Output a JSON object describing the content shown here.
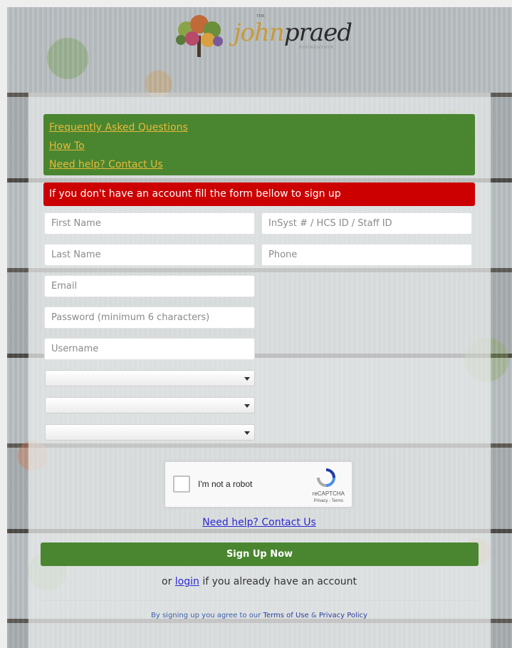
{
  "brand": {
    "the": "THE",
    "name_j": "john",
    "name_rest": "praed",
    "sub": "FOUNDATION"
  },
  "links": {
    "faq": "Frequently Asked Questions",
    "howto": "How To",
    "help": "Need help? Contact Us"
  },
  "alert": "If you don't have an account fill the form bellow to sign up",
  "form": {
    "first_name": "First Name",
    "insyst": "InSyst # / HCS ID / Staff ID",
    "last_name": "Last Name",
    "phone": "Phone",
    "email": "Email",
    "password": "Password (minimum 6 characters)",
    "username": "Username"
  },
  "selects": [
    "",
    "",
    ""
  ],
  "captcha": {
    "label": "I'm not a robot",
    "brand": "reCAPTCHA",
    "terms": "Privacy - Terms"
  },
  "help_link": "Need help? Contact Us",
  "signup_button": "Sign Up Now",
  "login": {
    "prefix": "or ",
    "link": "login",
    "suffix": " if you already have an account"
  },
  "agreement": {
    "prefix": "By signing up you agree to our ",
    "terms": "Terms of Use",
    "amp": " & ",
    "privacy": "Privacy Policy"
  },
  "colors": {
    "green": "#4a8630",
    "red": "#cc0000",
    "link_gold": "#e8b93a",
    "link_blue": "#2a2ad0"
  }
}
